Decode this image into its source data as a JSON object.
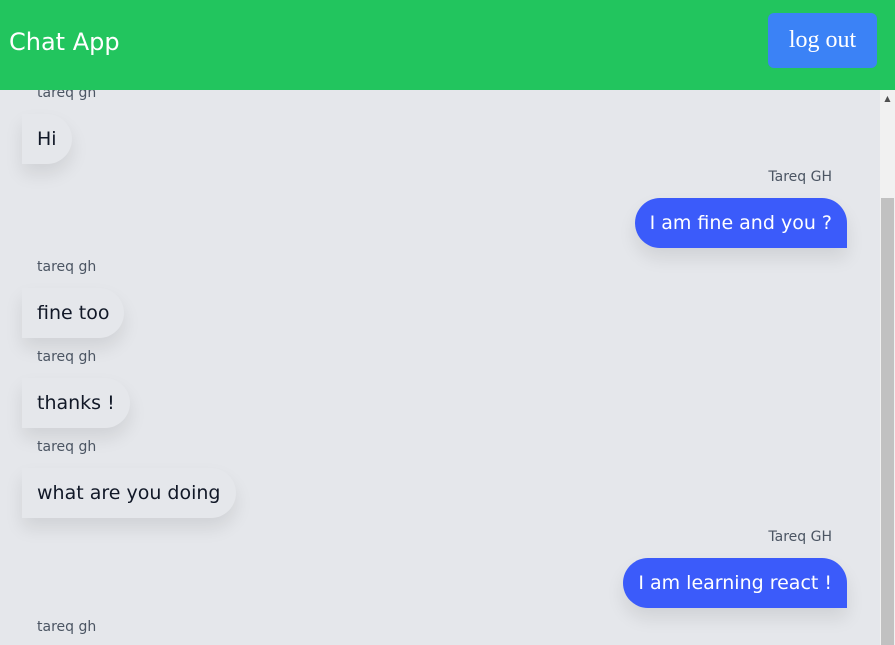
{
  "header": {
    "title": "Chat App",
    "logout_label": "log out",
    "background_color": "#22c55e",
    "button_color": "#3b82f6"
  },
  "messages": [
    {
      "sender": "tareq gh",
      "text": "Hi",
      "direction": "in"
    },
    {
      "sender": "Tareq GH",
      "text": "I am fine and you ?",
      "direction": "out"
    },
    {
      "sender": "tareq gh",
      "text": "fine too",
      "direction": "in"
    },
    {
      "sender": "tareq gh",
      "text": "thanks !",
      "direction": "in"
    },
    {
      "sender": "tareq gh",
      "text": "what are you doing",
      "direction": "in"
    },
    {
      "sender": "Tareq GH",
      "text": "I am learning react !",
      "direction": "out"
    },
    {
      "sender": "tareq gh",
      "text": "",
      "direction": "in"
    }
  ],
  "colors": {
    "outgoing_bubble": "#3b5bfa",
    "incoming_bubble": "#e5e7eb",
    "background": "#e5e7eb"
  },
  "icons": {
    "scroll_up": "scroll-up-arrow-icon"
  }
}
